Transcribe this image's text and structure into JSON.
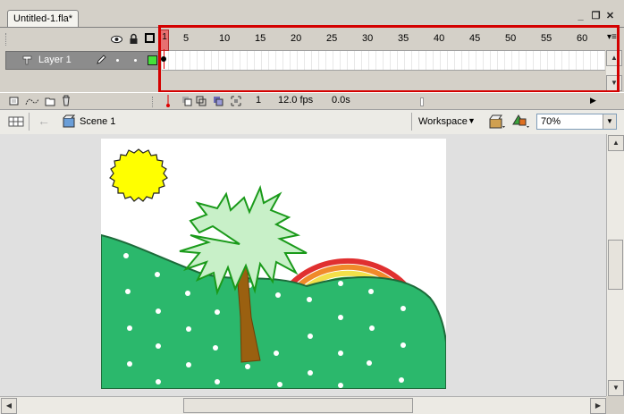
{
  "document": {
    "tab_title": "Untitled-1.fla*"
  },
  "window_controls": {
    "minimize": "_",
    "restore": "❐",
    "close": "✕"
  },
  "timeline": {
    "layer_name": "Layer 1",
    "frame_ticks": [
      "1",
      "5",
      "10",
      "15",
      "20",
      "25",
      "30",
      "35",
      "40",
      "45",
      "50",
      "55",
      "60"
    ],
    "current_frame": "1",
    "frame_rate": "12.0 fps",
    "elapsed_time": "0.0s"
  },
  "editbar": {
    "scene_label": "Scene 1",
    "workspace_label": "Workspace",
    "zoom_value": "70%"
  },
  "icons": [
    "eye-icon",
    "lock-icon",
    "outline-icon",
    "layer-icon",
    "pencil-icon",
    "insert-layer-icon",
    "motion-guide-icon",
    "folder-icon",
    "trash-icon",
    "scene-icon",
    "edit-symbols-icon",
    "edit-scene-icon"
  ]
}
